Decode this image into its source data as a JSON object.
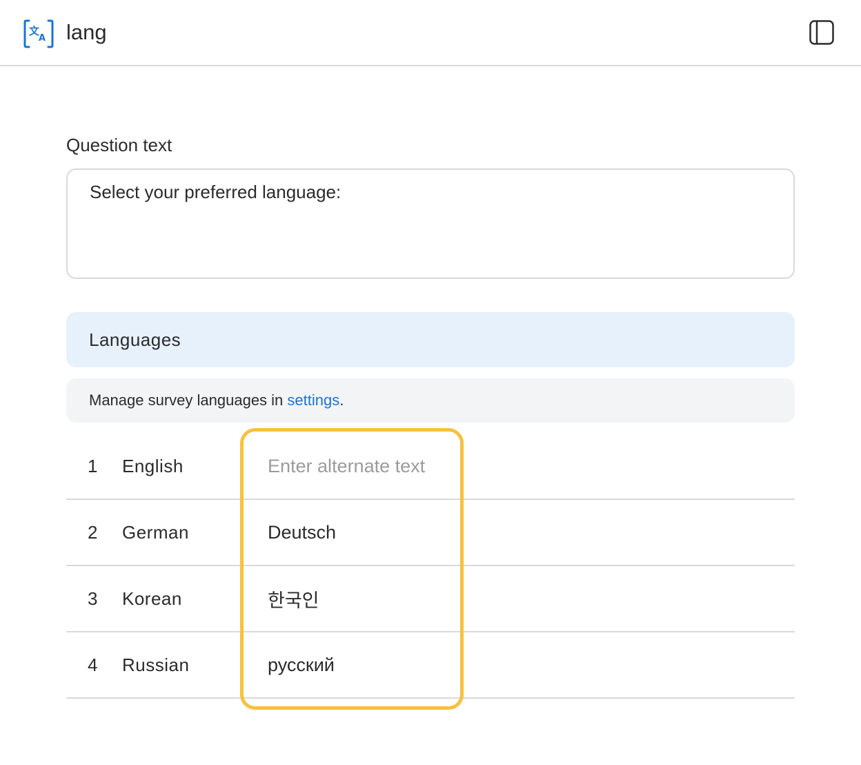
{
  "header": {
    "app_icon": "translate-icon",
    "title": "lang",
    "panel_toggle_icon": "sidebar-panel-icon"
  },
  "question": {
    "label": "Question text",
    "value": "Select your preferred language:"
  },
  "languages_section": {
    "title": "Languages",
    "info_prefix": "Manage survey languages in ",
    "info_link": "settings",
    "info_suffix": ".",
    "rows": [
      {
        "index": "1",
        "name": "English",
        "value": "",
        "placeholder": "Enter alternate text"
      },
      {
        "index": "2",
        "name": "German",
        "value": "Deutsch",
        "placeholder": "Enter alternate text"
      },
      {
        "index": "3",
        "name": "Korean",
        "value": "한국인",
        "placeholder": "Enter alternate text"
      },
      {
        "index": "4",
        "name": "Russian",
        "value": "русский",
        "placeholder": "Enter alternate text"
      }
    ]
  },
  "colors": {
    "accent": "#1a73d9",
    "highlight": "#f8c03e",
    "section_header_bg": "#e7f1fb",
    "info_bg": "#f3f4f6",
    "border": "#d9d9d9"
  }
}
